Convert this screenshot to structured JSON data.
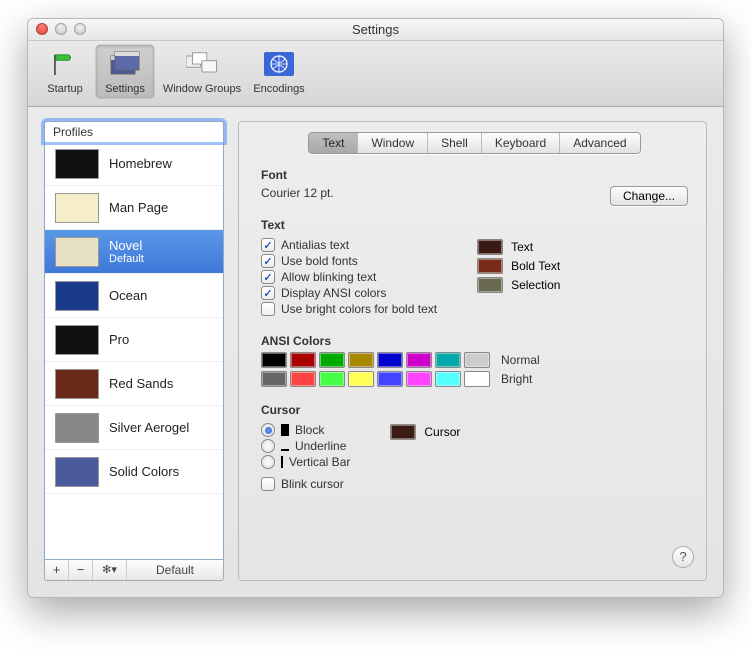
{
  "window": {
    "title": "Settings"
  },
  "toolbar": {
    "startup": "Startup",
    "settings": "Settings",
    "window_groups": "Window Groups",
    "encodings": "Encodings",
    "selected": "settings"
  },
  "sidebar": {
    "header": "Profiles",
    "items": [
      {
        "name": "Homebrew",
        "thumb": "dark"
      },
      {
        "name": "Man Page",
        "thumb": "light"
      },
      {
        "name": "Novel",
        "sub": "Default",
        "thumb": "paper",
        "selected": true
      },
      {
        "name": "Ocean",
        "thumb": "ocean"
      },
      {
        "name": "Pro",
        "thumb": "dark"
      },
      {
        "name": "Red Sands",
        "thumb": "red"
      },
      {
        "name": "Silver Aerogel",
        "thumb": "silver"
      },
      {
        "name": "Solid Colors",
        "thumb": "solid"
      }
    ],
    "footer": {
      "add": "+",
      "remove": "−",
      "gear": "✻▾",
      "default_btn": "Default"
    }
  },
  "tabs": {
    "text": "Text",
    "window": "Window",
    "shell": "Shell",
    "keyboard": "Keyboard",
    "advanced": "Advanced",
    "active": "text"
  },
  "font": {
    "heading": "Font",
    "value": "Courier 12 pt.",
    "change_btn": "Change..."
  },
  "text": {
    "heading": "Text",
    "antialias": {
      "label": "Antialias text",
      "checked": true
    },
    "bold": {
      "label": "Use bold fonts",
      "checked": true
    },
    "blink": {
      "label": "Allow blinking text",
      "checked": true
    },
    "ansi": {
      "label": "Display ANSI colors",
      "checked": true
    },
    "bright_bold": {
      "label": "Use bright colors for bold text",
      "checked": false
    },
    "swatches": {
      "text": {
        "label": "Text",
        "color": "#3a1a12"
      },
      "bold": {
        "label": "Bold Text",
        "color": "#7a2a18"
      },
      "selection": {
        "label": "Selection",
        "color": "#6a6a50"
      }
    }
  },
  "ansi": {
    "heading": "ANSI Colors",
    "normal_label": "Normal",
    "bright_label": "Bright",
    "normal": [
      "#000000",
      "#aa0000",
      "#00aa00",
      "#aa8800",
      "#0000cc",
      "#cc00cc",
      "#00aaaa",
      "#cccccc"
    ],
    "bright": [
      "#666666",
      "#ff4444",
      "#44ff44",
      "#ffff55",
      "#4444ff",
      "#ff44ff",
      "#55ffff",
      "#ffffff"
    ]
  },
  "cursor": {
    "heading": "Cursor",
    "block": "Block",
    "underline": "Underline",
    "vbar": "Vertical Bar",
    "selected": "block",
    "blink": {
      "label": "Blink cursor",
      "checked": false
    },
    "swatch": {
      "label": "Cursor",
      "color": "#3a1a12"
    }
  },
  "help": "?"
}
